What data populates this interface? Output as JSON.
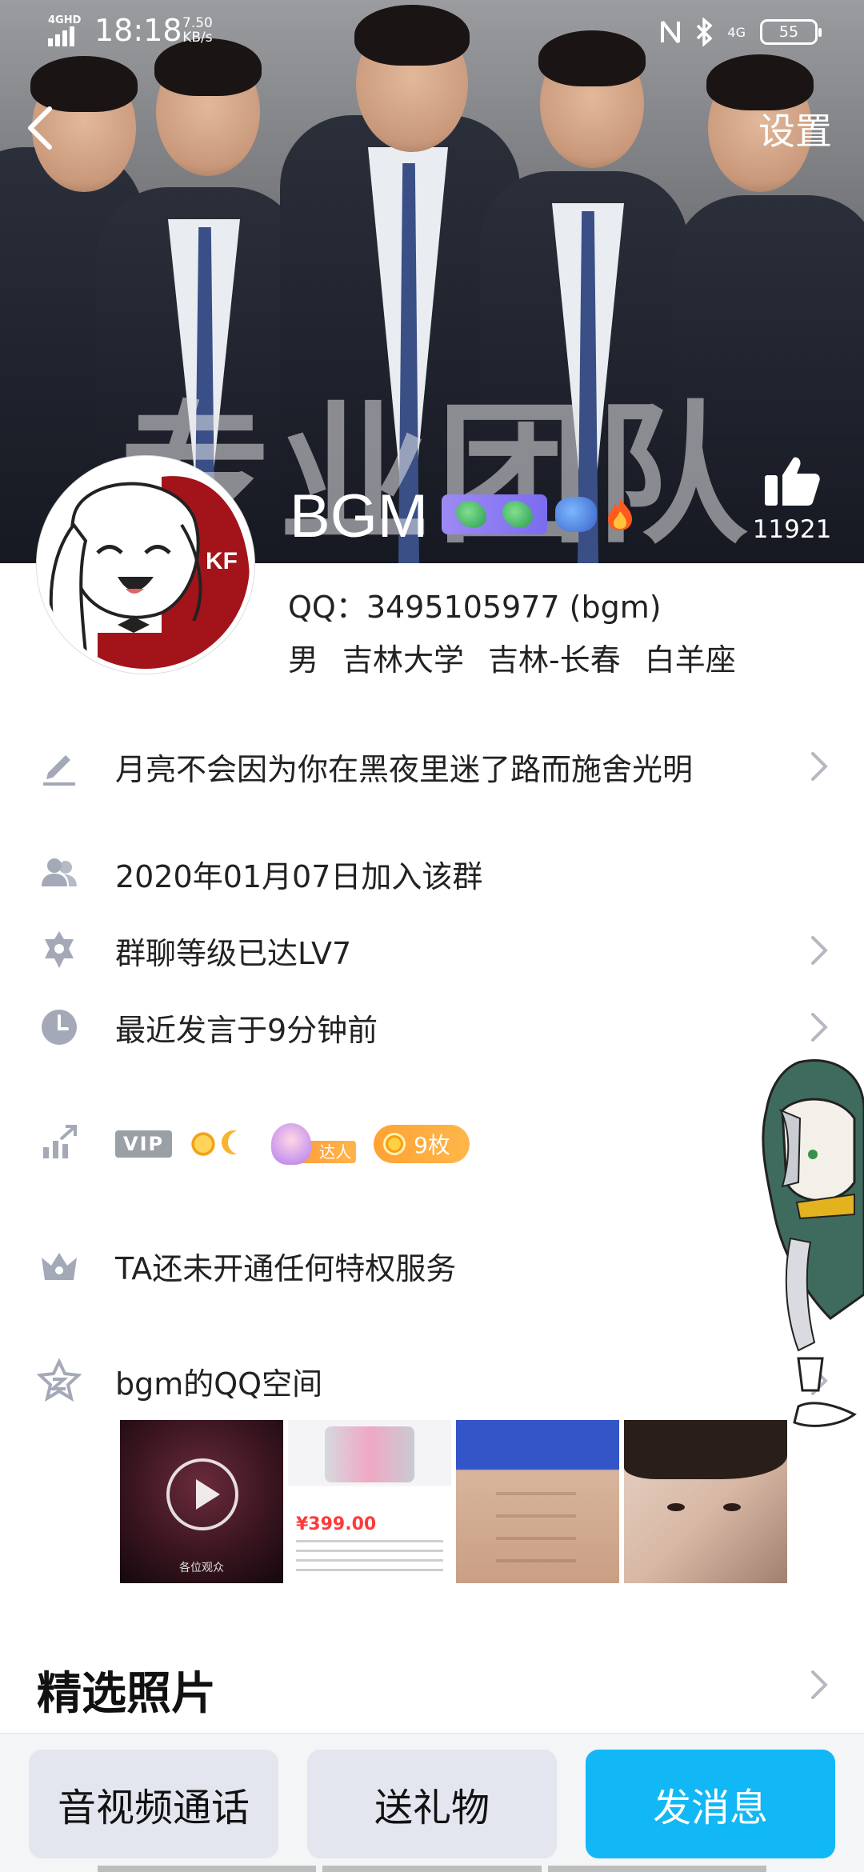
{
  "status_bar": {
    "network": "4GHD",
    "time": "18:18",
    "speed_value": "7.50",
    "speed_unit": "KB/s",
    "right_network": "4G",
    "battery": "55"
  },
  "nav": {
    "settings_label": "设置"
  },
  "banner": {
    "text": "专业团队"
  },
  "profile": {
    "nickname": "BGM",
    "like_count": "11921",
    "qq_line": "QQ：3495105977 (bgm)",
    "tags": [
      "男",
      "吉林大学",
      "吉林-长春",
      "白羊座"
    ]
  },
  "rows": {
    "signature": "月亮不会因为你在黑夜里迷了路而施舍光明",
    "join_date": "2020年01月07日加入该群",
    "group_level": "群聊等级已达LV7",
    "last_speak": "最近发言于9分钟前",
    "privilege": "TA还未开通任何特权服务",
    "qzone": "bgm的QQ空间"
  },
  "medals": {
    "vip_label": "VIP",
    "daren_label": "达人",
    "coin_label": "9枚"
  },
  "qzone_thumbs": {
    "video_caption": "各位观众",
    "price": "¥399.00"
  },
  "section": {
    "title": "精选照片"
  },
  "bottom_bar": {
    "call_label": "音视频通话",
    "gift_label": "送礼物",
    "message_label": "发消息"
  },
  "colors": {
    "primary": "#12b7f5",
    "secondary_button": "#e3e6ee",
    "icon_gray": "#a4a9b8",
    "coin_orange": "#ffa234"
  }
}
